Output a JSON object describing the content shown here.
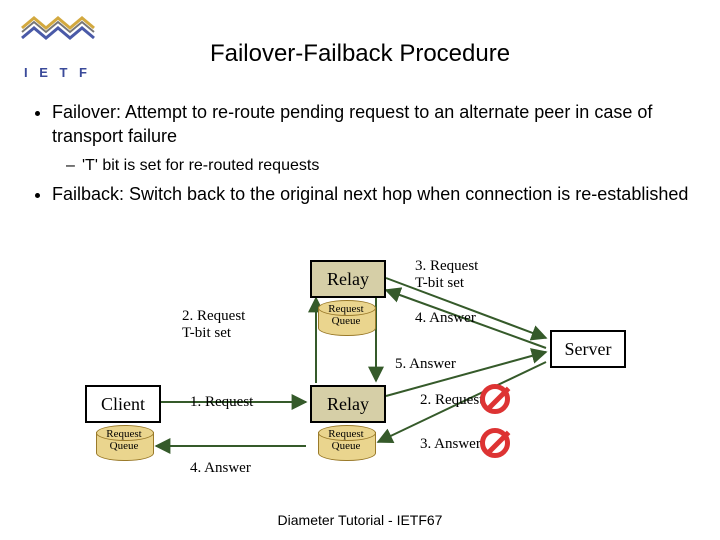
{
  "title": "Failover-Failback Procedure",
  "bullets": {
    "b1": "Failover: Attempt to re-route pending request to an alternate peer in case of transport failure",
    "b1sub": "'T' bit is set for re-routed requests",
    "b2": "Failback: Switch back to the original next hop when connection is re-established"
  },
  "diagram": {
    "client": "Client",
    "relay": "Relay",
    "server": "Server",
    "queue": "Request\nQueue",
    "edges": {
      "e1": "1. Request",
      "e2": "2. Request\nT-bit set",
      "e3": "3. Request\nT-bit set",
      "e4": "4. Answer",
      "e5": "5. Answer",
      "e6": "2. Request",
      "e7": "3. Answer",
      "e8": "4. Answer"
    }
  },
  "footer": "Diameter Tutorial - IETF67",
  "logo": {
    "text": "I E T F"
  }
}
